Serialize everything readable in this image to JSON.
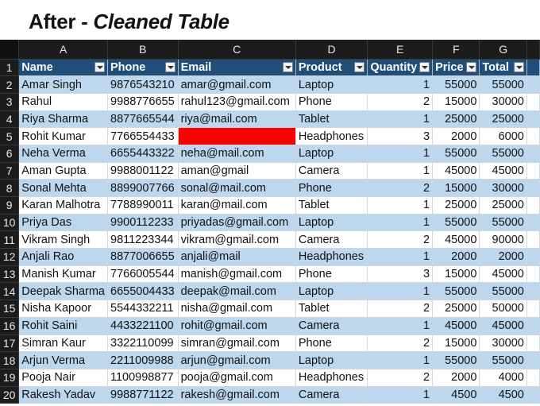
{
  "title": {
    "prefix": "After - ",
    "emphasis": "Cleaned Table"
  },
  "column_letters": [
    "A",
    "B",
    "C",
    "D",
    "E",
    "F",
    "G"
  ],
  "headers": [
    "Name",
    "Phone",
    "Email",
    "Product",
    "Quantity",
    "Price",
    "Total"
  ],
  "rows": [
    {
      "num": "2",
      "name": "Amar Singh",
      "phone": "9876543210",
      "email": "amar@gmail.com",
      "product": "Laptop",
      "quantity": "1",
      "price": "55000",
      "total": "55000"
    },
    {
      "num": "3",
      "name": "Rahul",
      "phone": "9988776655",
      "email": "rahul123@gmail.com",
      "product": "Phone",
      "quantity": "2",
      "price": "15000",
      "total": "30000"
    },
    {
      "num": "4",
      "name": "Riya Sharma",
      "phone": "8877665544",
      "email": "riya@mail.com",
      "product": "Tablet",
      "quantity": "1",
      "price": "25000",
      "total": "25000"
    },
    {
      "num": "5",
      "name": "Rohit Kumar",
      "phone": "7766554433",
      "email": "",
      "product": "Headphones",
      "quantity": "3",
      "price": "2000",
      "total": "6000",
      "email_highlight": "#ff0000"
    },
    {
      "num": "6",
      "name": "Neha Verma",
      "phone": "6655443322",
      "email": "neha@mail.com",
      "product": "Laptop",
      "quantity": "1",
      "price": "55000",
      "total": "55000"
    },
    {
      "num": "7",
      "name": "Aman Gupta",
      "phone": "9988001122",
      "email": "aman@gmail",
      "product": "Camera",
      "quantity": "1",
      "price": "45000",
      "total": "45000"
    },
    {
      "num": "8",
      "name": "Sonal Mehta",
      "phone": "8899007766",
      "email": "sonal@mail.com",
      "product": "Phone",
      "quantity": "2",
      "price": "15000",
      "total": "30000"
    },
    {
      "num": "9",
      "name": "Karan Malhotra",
      "phone": "7788990011",
      "email": "karan@mail.com",
      "product": "Tablet",
      "quantity": "1",
      "price": "25000",
      "total": "25000"
    },
    {
      "num": "10",
      "name": "Priya Das",
      "phone": "9900112233",
      "email": "priyadas@gmail.com",
      "product": "Laptop",
      "quantity": "1",
      "price": "55000",
      "total": "55000"
    },
    {
      "num": "11",
      "name": "Vikram Singh",
      "phone": "9811223344",
      "email": "vikram@gmail.com",
      "product": "Camera",
      "quantity": "2",
      "price": "45000",
      "total": "90000"
    },
    {
      "num": "12",
      "name": "Anjali Rao",
      "phone": "8877006655",
      "email": "anjali@mail",
      "product": "Headphones",
      "quantity": "1",
      "price": "2000",
      "total": "2000"
    },
    {
      "num": "13",
      "name": "Manish Kumar",
      "phone": "7766005544",
      "email": "manish@gmail.com",
      "product": "Phone",
      "quantity": "3",
      "price": "15000",
      "total": "45000"
    },
    {
      "num": "14",
      "name": "Deepak Sharma",
      "phone": "6655004433",
      "email": "deepak@mail.com",
      "product": "Laptop",
      "quantity": "1",
      "price": "55000",
      "total": "55000"
    },
    {
      "num": "15",
      "name": "Nisha Kapoor",
      "phone": "5544332211",
      "email": "nisha@gmail.com",
      "product": "Tablet",
      "quantity": "2",
      "price": "25000",
      "total": "50000"
    },
    {
      "num": "16",
      "name": "Rohit Saini",
      "phone": "4433221100",
      "email": "rohit@gmail.com",
      "product": "Camera",
      "quantity": "1",
      "price": "45000",
      "total": "45000"
    },
    {
      "num": "17",
      "name": "Simran Kaur",
      "phone": "3322110099",
      "email": "simran@gmail.com",
      "product": "Phone",
      "quantity": "2",
      "price": "15000",
      "total": "30000"
    },
    {
      "num": "18",
      "name": "Arjun Verma",
      "phone": "2211009988",
      "email": "arjun@gmail.com",
      "product": "Laptop",
      "quantity": "1",
      "price": "55000",
      "total": "55000"
    },
    {
      "num": "19",
      "name": "Pooja Nair",
      "phone": "1100998877",
      "email": "pooja@gmail.com",
      "product": "Headphones",
      "quantity": "2",
      "price": "2000",
      "total": "4000"
    },
    {
      "num": "20",
      "name": "Rakesh Yadav",
      "phone": "9988771122",
      "email": "rakesh@gmail.com",
      "product": "Camera",
      "quantity": "1",
      "price": "4500",
      "total": "4500"
    }
  ],
  "colors": {
    "header_bg": "#1f4e79",
    "band_bg": "#bdd7ee",
    "sheet_chrome": "#1c1c1c",
    "highlight": "#ff0000"
  }
}
